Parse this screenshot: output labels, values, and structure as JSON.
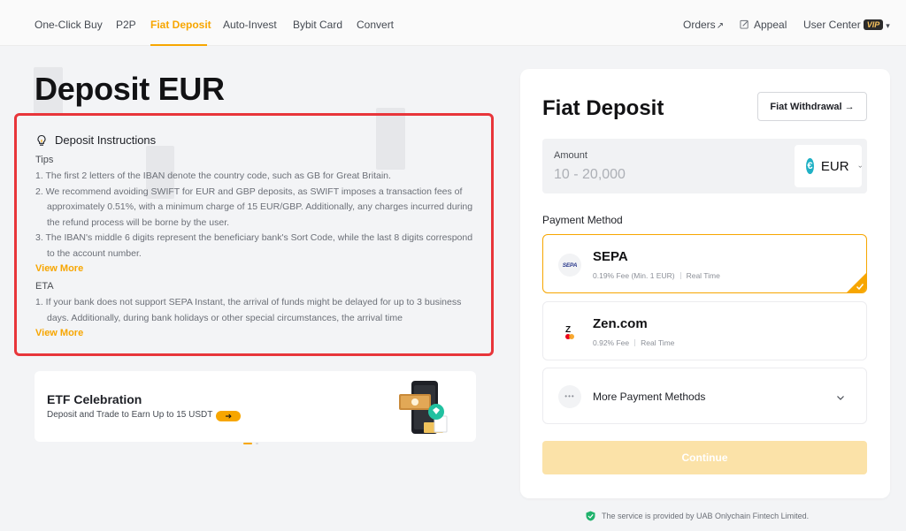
{
  "nav": {
    "items": [
      {
        "label": "One-Click Buy",
        "active": false
      },
      {
        "label": "P2P",
        "active": false
      },
      {
        "label": "Fiat Deposit",
        "active": true
      },
      {
        "label": "Auto-Invest",
        "active": false
      },
      {
        "label": "Bybit Card",
        "active": false
      },
      {
        "label": "Convert",
        "active": false
      }
    ],
    "orders_label": "Orders",
    "orders_arrow": "↗",
    "appeal_label": "Appeal",
    "user_center_label": "User Center",
    "vip_badge": "VIP",
    "dropdown_arrow": "▾"
  },
  "page": {
    "title": "Deposit EUR"
  },
  "instructions": {
    "header": "Deposit Instructions",
    "tips_label": "Tips",
    "tips": [
      "1. The first 2 letters of the IBAN denote the country code, such as GB for Great Britain.",
      "2. We recommend avoiding SWIFT for EUR and GBP deposits, as SWIFT imposes a transaction fees of approximately 0.51%, with a minimum charge of 15 EUR/GBP. Additionally, any charges incurred during the refund process will be borne by the user.",
      "3. The IBAN's middle 6 digits represent the beneficiary bank's Sort Code, while the last 8 digits correspond to the account number."
    ],
    "view_more_1": "View More",
    "eta_label": "ETA",
    "eta": [
      "1. If your bank does not support SEPA Instant, the arrival of funds might be delayed for up to 3 business days. Additionally, during bank holidays or other special circumstances, the arrival time"
    ],
    "view_more_2": "View More"
  },
  "promo": {
    "title": "ETF Celebration",
    "subtitle": "Deposit and Trade to Earn Up to 15 USDT",
    "arrow": "➔"
  },
  "deposit_card": {
    "title": "Fiat Deposit",
    "withdraw_button": "Fiat Withdrawal →",
    "amount_label": "Amount",
    "amount_placeholder": "10 - 20,000",
    "currency": "EUR",
    "currency_symbol": "€",
    "payment_method_label": "Payment Method",
    "methods": [
      {
        "name": "SEPA",
        "logo_text": "SEPA",
        "fee": "0.19% Fee (Min. 1 EUR)",
        "speed": "Real Time",
        "selected": true
      },
      {
        "name": "Zen.com",
        "logo_text": "Z",
        "fee": "0.92% Fee",
        "speed": "Real Time",
        "selected": false
      }
    ],
    "more_methods_label": "More Payment Methods",
    "more_dots": "•••",
    "continue_label": "Continue"
  },
  "footer": {
    "note": "The service is provided by UAB Onlychain Fintech Limited."
  },
  "colors": {
    "accent": "#f7a600",
    "highlight_border": "#e8353a",
    "continue_disabled": "#fbe2a8",
    "eur_icon": "#20b1c5",
    "shield": "#20b26c"
  },
  "icons": [
    "bulb-icon",
    "edit-icon",
    "euro-icon",
    "chevron-down-icon",
    "check-icon",
    "shield-check-icon",
    "sepa-logo",
    "zen-logo",
    "more-dots-icon"
  ]
}
